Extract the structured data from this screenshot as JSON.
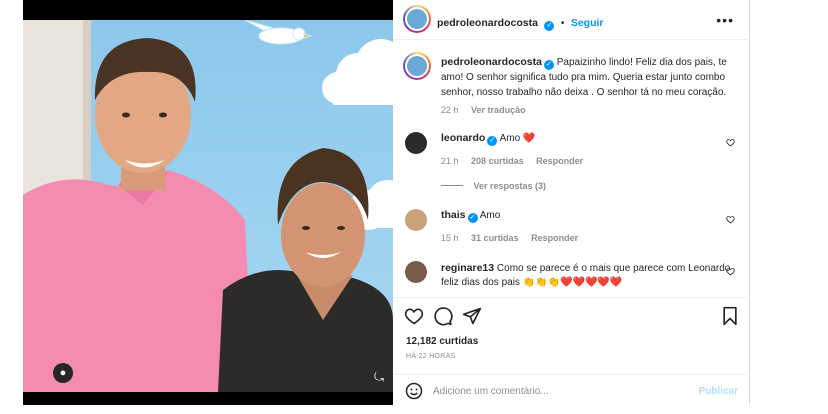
{
  "post": {
    "author": "pedroleonardocosta",
    "follow_label": "Seguir",
    "dot": "•",
    "more_icon": "more-horizontal-icon",
    "caption": "Papaizinho lindo! Feliz dia dos pais, te amo! O senhor significa tudo pra mim. Queria estar junto combo senhor, nosso trabalho não deixa . O senhor tá no meu coração.",
    "caption_time": "22 h",
    "translate_label": "Ver tradução",
    "likes": "12,182 curtidas",
    "time_ago": "HÁ 22 HORAS",
    "comment_placeholder": "Adicione um comentário...",
    "publish_label": "Publicar"
  },
  "comments": [
    {
      "user": "leonardo",
      "text": "Amo",
      "emoji": "❤️",
      "time": "21 h",
      "likes": "208 curtidas",
      "reply": "Responder",
      "view_replies": "Ver respostas (3)"
    },
    {
      "user": "thais",
      "text": "Amo",
      "time": "15 h",
      "likes": "31 curtidas",
      "reply": "Responder"
    },
    {
      "user": "reginare13",
      "text": "Como se parece é o mais que parece com Leonardo feliz dias dos pais 👏👏👏❤️❤️❤️❤️❤️"
    }
  ],
  "colors": {
    "accent": "#0095f6",
    "heart": "#ed4956",
    "shirt_pink": "#f48bb0",
    "sky": "#8fc9ec"
  }
}
